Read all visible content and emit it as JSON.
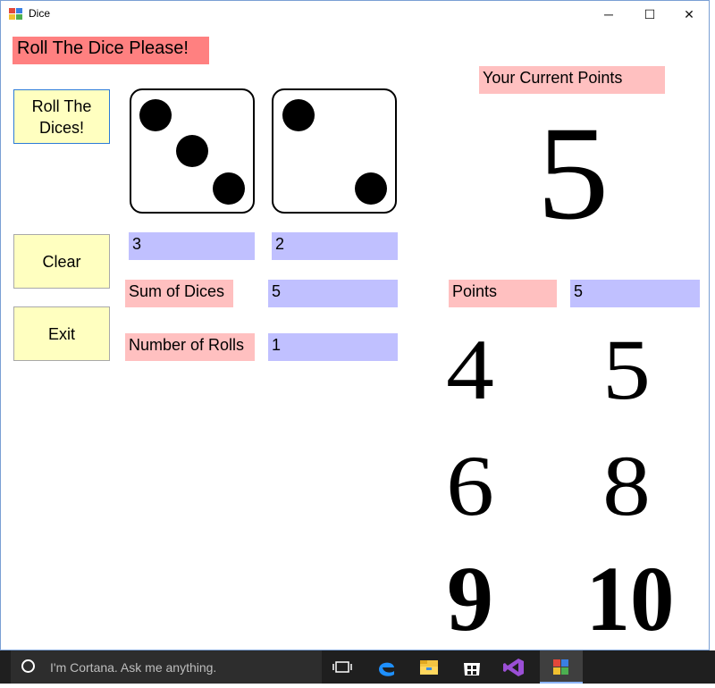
{
  "window": {
    "title": "Dice",
    "controls": {
      "minimize": "─",
      "maximize": "☐",
      "close": "✕"
    }
  },
  "heading": "Roll The Dice Please!",
  "buttons": {
    "roll": "Roll The Dices!",
    "clear": "Clear",
    "exit": "Exit"
  },
  "dice": [
    3,
    2
  ],
  "die_boxes": [
    "3",
    "2"
  ],
  "sum": {
    "label": "Sum of Dices",
    "value": "5"
  },
  "rolls": {
    "label": "Number of Rolls",
    "value": "1"
  },
  "current": {
    "label": "Your Current Points",
    "value": "5"
  },
  "points": {
    "label": "Points",
    "value": "5"
  },
  "point_numbers": [
    "4",
    "5",
    "6",
    "8",
    "9",
    "10"
  ],
  "taskbar": {
    "search_placeholder": "I'm Cortana. Ask me anything."
  }
}
